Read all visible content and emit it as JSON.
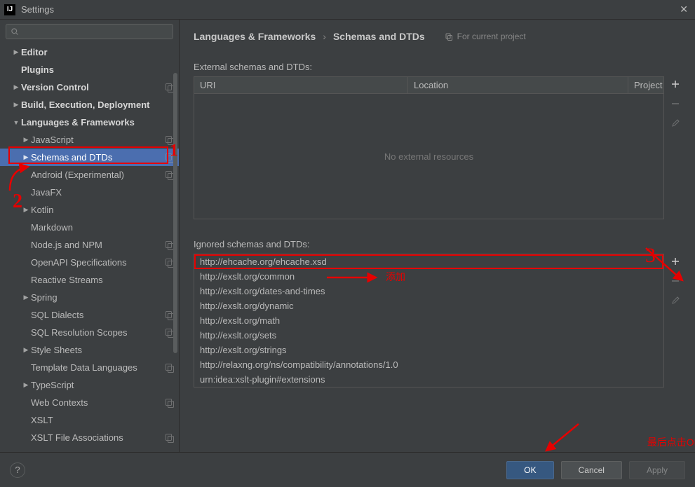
{
  "window": {
    "title": "Settings"
  },
  "search": {
    "placeholder": ""
  },
  "sidebar": {
    "items": [
      {
        "label": "Editor",
        "depth": 0,
        "arrow": ">",
        "bold": true,
        "badge": false
      },
      {
        "label": "Plugins",
        "depth": 0,
        "arrow": "",
        "bold": true,
        "badge": false
      },
      {
        "label": "Version Control",
        "depth": 0,
        "arrow": ">",
        "bold": true,
        "badge": true
      },
      {
        "label": "Build, Execution, Deployment",
        "depth": 0,
        "arrow": ">",
        "bold": true,
        "badge": false
      },
      {
        "label": "Languages & Frameworks",
        "depth": 0,
        "arrow": "v",
        "bold": true,
        "badge": false
      },
      {
        "label": "JavaScript",
        "depth": 1,
        "arrow": ">",
        "bold": false,
        "badge": true
      },
      {
        "label": "Schemas and DTDs",
        "depth": 1,
        "arrow": ">",
        "bold": false,
        "badge": true,
        "selected": true
      },
      {
        "label": "Android (Experimental)",
        "depth": 1,
        "arrow": "",
        "bold": false,
        "badge": true
      },
      {
        "label": "JavaFX",
        "depth": 1,
        "arrow": "",
        "bold": false,
        "badge": false
      },
      {
        "label": "Kotlin",
        "depth": 1,
        "arrow": ">",
        "bold": false,
        "badge": false
      },
      {
        "label": "Markdown",
        "depth": 1,
        "arrow": "",
        "bold": false,
        "badge": false
      },
      {
        "label": "Node.js and NPM",
        "depth": 1,
        "arrow": "",
        "bold": false,
        "badge": true
      },
      {
        "label": "OpenAPI Specifications",
        "depth": 1,
        "arrow": "",
        "bold": false,
        "badge": true
      },
      {
        "label": "Reactive Streams",
        "depth": 1,
        "arrow": "",
        "bold": false,
        "badge": false
      },
      {
        "label": "Spring",
        "depth": 1,
        "arrow": ">",
        "bold": false,
        "badge": false
      },
      {
        "label": "SQL Dialects",
        "depth": 1,
        "arrow": "",
        "bold": false,
        "badge": true
      },
      {
        "label": "SQL Resolution Scopes",
        "depth": 1,
        "arrow": "",
        "bold": false,
        "badge": true
      },
      {
        "label": "Style Sheets",
        "depth": 1,
        "arrow": ">",
        "bold": false,
        "badge": false
      },
      {
        "label": "Template Data Languages",
        "depth": 1,
        "arrow": "",
        "bold": false,
        "badge": true
      },
      {
        "label": "TypeScript",
        "depth": 1,
        "arrow": ">",
        "bold": false,
        "badge": false
      },
      {
        "label": "Web Contexts",
        "depth": 1,
        "arrow": "",
        "bold": false,
        "badge": true
      },
      {
        "label": "XSLT",
        "depth": 1,
        "arrow": "",
        "bold": false,
        "badge": false
      },
      {
        "label": "XSLT File Associations",
        "depth": 1,
        "arrow": "",
        "bold": false,
        "badge": true
      }
    ]
  },
  "breadcrumb": {
    "parent": "Languages & Frameworks",
    "current": "Schemas and DTDs",
    "scope": "For current project"
  },
  "externalSection": {
    "label": "External schemas and DTDs:",
    "headers": {
      "uri": "URI",
      "location": "Location",
      "project": "Project"
    },
    "empty": "No external resources"
  },
  "ignoredSection": {
    "label": "Ignored schemas and DTDs:",
    "items": [
      "http://ehcache.org/ehcache.xsd",
      "http://exslt.org/common",
      "http://exslt.org/dates-and-times",
      "http://exslt.org/dynamic",
      "http://exslt.org/math",
      "http://exslt.org/sets",
      "http://exslt.org/strings",
      "http://relaxng.org/ns/compatibility/annotations/1.0",
      "urn:idea:xslt-plugin#extensions"
    ]
  },
  "annotations": {
    "mark1": "1",
    "mark2": "2",
    "mark3": "3",
    "add": "添加",
    "finalOk": "最后点击OK"
  },
  "footer": {
    "ok": "OK",
    "cancel": "Cancel",
    "apply": "Apply",
    "help": "?"
  }
}
